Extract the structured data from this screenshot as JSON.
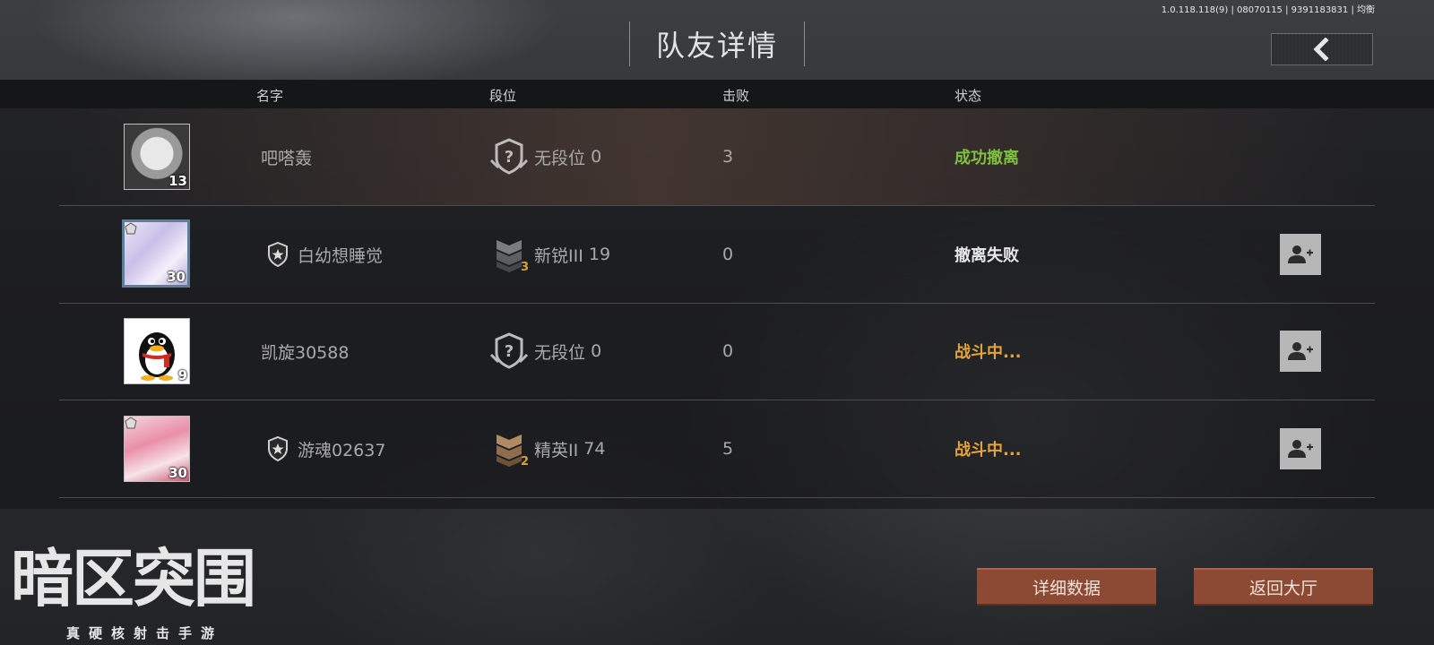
{
  "version": "1.0.118.118(9) | 08070115 | 9391183831 | 均衡",
  "title": "队友详情",
  "back_icon": "chevron-left-icon",
  "columns": {
    "name": "名字",
    "rank": "段位",
    "kills": "击败",
    "status": "状态"
  },
  "teammates": [
    {
      "name": "吧嗒轰",
      "level": "13",
      "has_badge": false,
      "rank": "无段位",
      "rank_points": "0",
      "rank_icon": "unknown-rank-icon",
      "rank_tier": "",
      "kills": "3",
      "status": "成功撤离",
      "status_color": "#7ec13e",
      "can_add": false
    },
    {
      "name": "白幼想睡觉",
      "level": "30",
      "has_badge": true,
      "rank": "新锐III",
      "rank_points": "19",
      "rank_icon": "rookie-rank-icon",
      "rank_tier": "3",
      "kills": "0",
      "status": "撤离失败",
      "status_color": "#e8e8e8",
      "can_add": true
    },
    {
      "name": "凯旋30588",
      "level": "9",
      "has_badge": false,
      "rank": "无段位",
      "rank_points": "0",
      "rank_icon": "unknown-rank-icon",
      "rank_tier": "",
      "kills": "0",
      "status": "战斗中...",
      "status_color": "#e6a33c",
      "can_add": true
    },
    {
      "name": "游魂02637",
      "level": "30",
      "has_badge": true,
      "rank": "精英II",
      "rank_points": "74",
      "rank_icon": "elite-rank-icon",
      "rank_tier": "2",
      "kills": "5",
      "status": "战斗中...",
      "status_color": "#e6a33c",
      "can_add": true
    }
  ],
  "logo": {
    "main": "暗区突围",
    "sub": "真硬核射击手游"
  },
  "buttons": {
    "details": "详细数据",
    "lobby": "返回大厅"
  },
  "colors": {
    "button_bg": "#8c4a35",
    "add_btn_bg": "#b7b7b7"
  }
}
